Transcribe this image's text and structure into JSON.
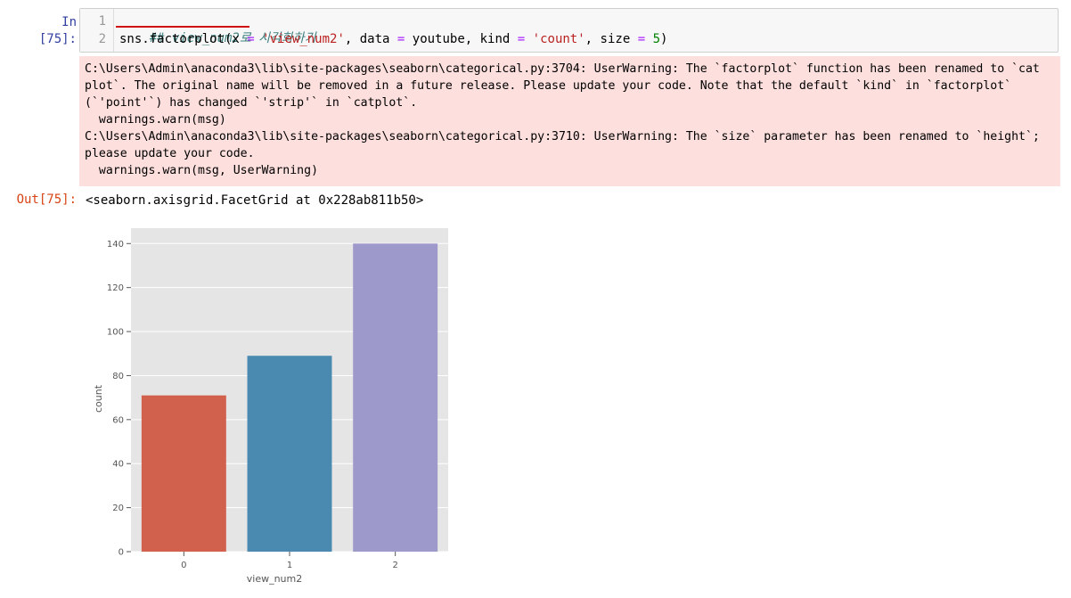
{
  "input_cell": {
    "prompt": "In [75]:",
    "line_numbers": [
      "1",
      "2"
    ],
    "line1_comment": "## view_num2로 시각화하기",
    "line2": {
      "t1": "sns.factorplot(x ",
      "op1": "=",
      "t2": " ",
      "str1": "'view_num2'",
      "t3": ", data ",
      "op2": "=",
      "t4": " youtube, kind ",
      "op3": "=",
      "t5": " ",
      "str2": "'count'",
      "t6": ", size ",
      "op4": "=",
      "t7": " ",
      "num1": "5",
      "t8": ")"
    }
  },
  "stderr": {
    "lines": [
      "C:\\Users\\Admin\\anaconda3\\lib\\site-packages\\seaborn\\categorical.py:3704: UserWarning: The `factorplot` function has been renamed to `cat",
      "plot`. The original name will be removed in a future release. Please update your code. Note that the default `kind` in `factorplot`",
      "(`'point'`) has changed `'strip'` in `catplot`.",
      "  warnings.warn(msg)",
      "C:\\Users\\Admin\\anaconda3\\lib\\site-packages\\seaborn\\categorical.py:3710: UserWarning: The `size` parameter has been renamed to `height`;",
      "please update your code.",
      "  warnings.warn(msg, UserWarning)"
    ]
  },
  "output": {
    "prompt": "Out[75]:",
    "repr": "<seaborn.axisgrid.FacetGrid at 0x228ab811b50>"
  },
  "chart_data": {
    "type": "bar",
    "categories": [
      "0",
      "1",
      "2"
    ],
    "values": [
      71,
      89,
      140
    ],
    "colors": [
      "#d1604c",
      "#4a8ab0",
      "#9e99cb"
    ],
    "xlabel": "view_num2",
    "ylabel": "count",
    "ylim": [
      0,
      140
    ],
    "yticks": [
      "0",
      "20",
      "40",
      "60",
      "80",
      "100",
      "120",
      "140"
    ],
    "grid": true,
    "background": "#e5e5e5"
  }
}
